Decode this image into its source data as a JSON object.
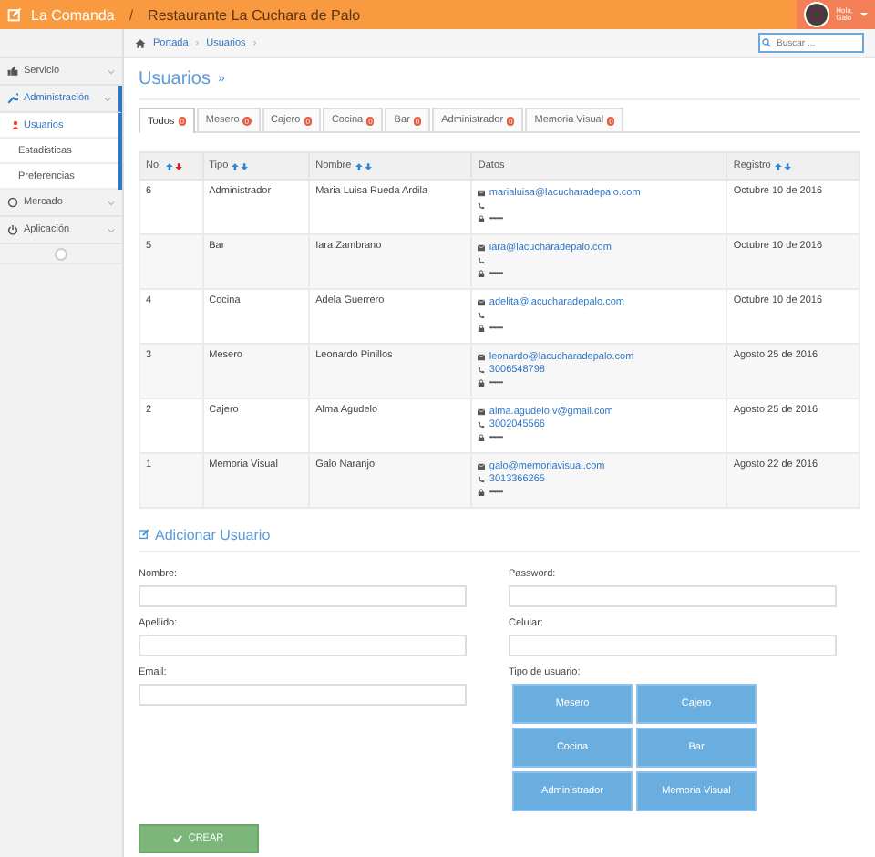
{
  "header": {
    "brand": "La Comanda",
    "separator": "/",
    "title": "Restaurante La Cuchara de Palo",
    "greeting": [
      "Hola,",
      "Galo"
    ]
  },
  "sidebar": {
    "items": [
      {
        "label": "Servicio",
        "selected": false
      },
      {
        "label": "Administración",
        "selected": true,
        "children": [
          {
            "label": "Usuarios",
            "selected": true
          },
          {
            "label": "Estadisticas",
            "selected": false
          },
          {
            "label": "Preferencias",
            "selected": false
          }
        ]
      },
      {
        "label": "Mercado",
        "selected": false
      },
      {
        "label": "Aplicación",
        "selected": false
      }
    ]
  },
  "breadcrumb": {
    "items": [
      "Portada",
      "Usuarios"
    ],
    "separator": "›"
  },
  "search": {
    "placeholder": "Buscar ..."
  },
  "page_title": "Usuarios",
  "page_title_suffix": "»",
  "tabs": [
    {
      "label": "Todos",
      "badge": "0",
      "selected": true
    },
    {
      "label": "Mesero",
      "badge": "0",
      "selected": false
    },
    {
      "label": "Cajero",
      "badge": "0",
      "selected": false
    },
    {
      "label": "Cocina",
      "badge": "0",
      "selected": false
    },
    {
      "label": "Bar",
      "badge": "0",
      "selected": false
    },
    {
      "label": "Administrador",
      "badge": "0",
      "selected": false
    },
    {
      "label": "Memoria Visual",
      "badge": "0",
      "selected": false
    }
  ],
  "table": {
    "columns": [
      {
        "label": "No.",
        "sortable": true,
        "descending": true
      },
      {
        "label": "Tipo",
        "sortable": true,
        "descending": false
      },
      {
        "label": "Nombre",
        "sortable": true,
        "descending": false
      },
      {
        "label": "Datos",
        "sortable": false
      },
      {
        "label": "Registro",
        "sortable": true,
        "descending": false
      }
    ],
    "rows": [
      {
        "no": "6",
        "tipo": "Administrador",
        "nombre": "Maria Luisa Rueda Ardila",
        "email": "marialuisa@lacucharadepalo.com",
        "registro": "Octubre 10 de 2016"
      },
      {
        "no": "5",
        "tipo": "Bar",
        "nombre": "Iara Zambrano",
        "email": "iara@lacucharadepalo.com",
        "registro": "Octubre 10 de 2016"
      },
      {
        "no": "4",
        "tipo": "Cocina",
        "nombre": "Adela Guerrero",
        "email": "adelita@lacucharadepalo.com",
        "registro": "Octubre 10 de 2016"
      },
      {
        "no": "3",
        "tipo": "Mesero",
        "nombre": "Leonardo Pinillos",
        "email": "leonardo@lacucharadepalo.com",
        "phone": "3006548798",
        "registro": "Agosto 25 de 2016"
      },
      {
        "no": "2",
        "tipo": "Cajero",
        "nombre": "Alma Agudelo",
        "email": "alma.agudelo.v@gmail.com",
        "phone": "3002045566",
        "registro": "Agosto 25 de 2016"
      },
      {
        "no": "1",
        "tipo": "Memoria Visual",
        "nombre": "Galo Naranjo",
        "email": "galo@memoriavisual.com",
        "phone": "3013366265",
        "registro": "Agosto 22 de 2016"
      }
    ],
    "password_mask": "••••••••"
  },
  "form": {
    "title": "Adicionar Usuario",
    "left_fields": [
      "Nombre:",
      "Apellido:",
      "Email:"
    ],
    "right_fields": [
      "Password:",
      "Celular:"
    ],
    "type_label": "Tipo de usuario:",
    "types": [
      "Mesero",
      "Cajero",
      "Cocina",
      "Bar",
      "Administrador",
      "Memoria Visual"
    ],
    "submit": "CREAR"
  }
}
